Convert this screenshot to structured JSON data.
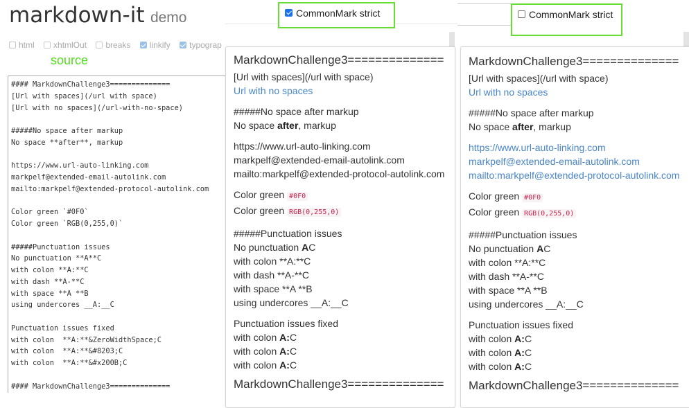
{
  "header": {
    "title": "markdown-it",
    "subtitle": "demo"
  },
  "options": [
    {
      "label": "html",
      "checked": false
    },
    {
      "label": "xhtmlOut",
      "checked": false
    },
    {
      "label": "breaks",
      "checked": false
    },
    {
      "label": "linkify",
      "checked": true
    },
    {
      "label": "typograp",
      "checked": true
    }
  ],
  "source_label": "source",
  "source_text": "#### MarkdownChallenge3==============\n[Url with spaces](/url with space)\n[Url with no spaces](/url-with-no-space)\n\n#####No space after markup\nNo space **after**, markup\n\nhttps://www.url-auto-linking.com\nmarkpelf@extended-email-autolink.com\nmailto:markpelf@extended-protocol-autolink.com\n\nColor green `#0F0`\nColor green `RGB(0,255,0)`\n\n#####Punctuation issues\nNo punctuation **A**C\nwith colon **A:**C\nwith dash **A-**C\nwith space **A **B\nusing undercores __A:__C\n\nPunctuation issues fixed\nwith colon  **A:**&ZeroWidthSpace;C\nwith colon  **A:**&#8203;C\nwith colon  **A:**&#x200B;C\n\n#### MarkdownChallenge3==============",
  "strict_left": {
    "label": "CommonMark strict",
    "checked": true
  },
  "strict_right": {
    "label": "CommonMark strict",
    "checked": false
  },
  "result": {
    "heading": "MarkdownChallenge3==============",
    "url_spaces": "[Url with spaces](/url with space)",
    "url_no_spaces": "Url with no spaces",
    "h5_nospace": "#####No space after markup",
    "nospace_pre": "No space ",
    "nospace_bold": "after",
    "nospace_post": ", markup",
    "link1": "https://www.url-auto-linking.com",
    "link2": "markpelf@extended-email-autolink.com",
    "link3": "mailto:markpelf@extended-protocol-autolink.com",
    "color_label": "Color green ",
    "code1": "#0F0",
    "code2": "RGB(0,255,0)",
    "h5_punct": "#####Punctuation issues",
    "nopunct_pre": "No punctuation ",
    "nopunct_bold": "A",
    "nopunct_post": "C",
    "colon_line": "with colon **A:**C",
    "dash_line": "with dash **A-**C",
    "space_line": "with space **A **B",
    "under_line": "using undercores __A:__C",
    "fixed_title": "Punctuation issues fixed",
    "fixed_pre": "with colon ",
    "fixed_bold": "A:",
    "fixed_post": "C",
    "heading_bottom": "MarkdownChallenge3=============="
  },
  "colors": {
    "strict_highlight": "#66dd33",
    "source_label": "#55dd22",
    "link": "#4a86c8",
    "code": "#c7254e"
  }
}
